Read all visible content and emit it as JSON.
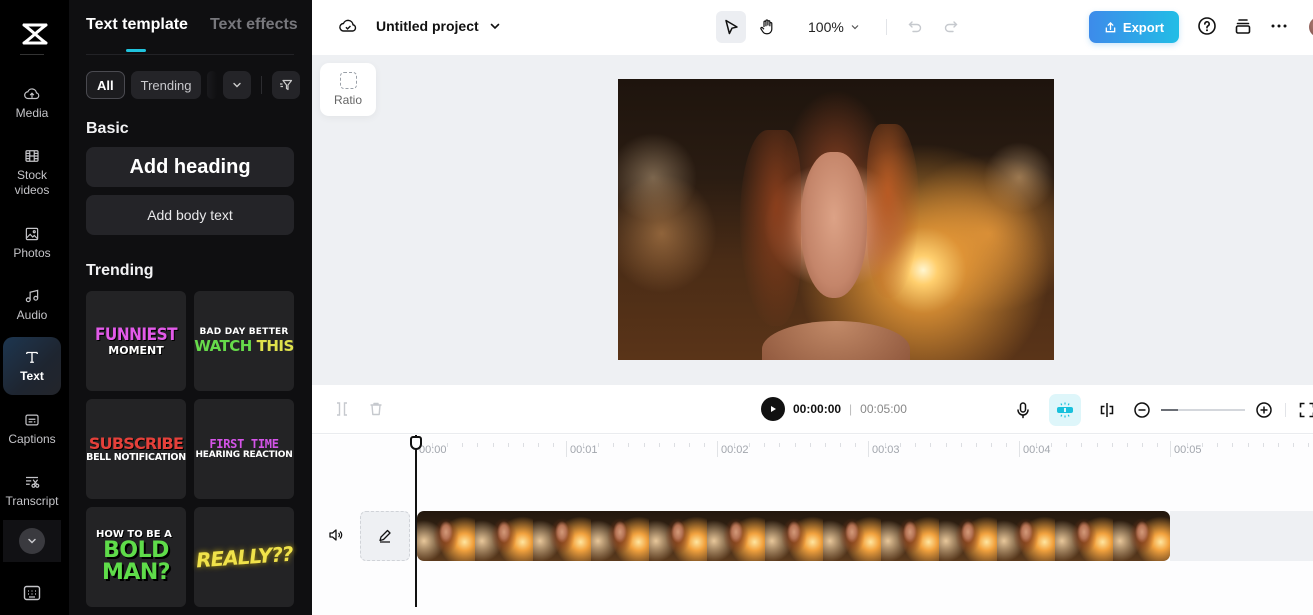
{
  "rail": {
    "logo": "capcut-logo",
    "items": [
      {
        "label": "Media",
        "icon": "cloud-upload-icon"
      },
      {
        "label": "Stock\nvideos",
        "icon": "film-icon"
      },
      {
        "label": "Photos",
        "icon": "image-icon"
      },
      {
        "label": "Audio",
        "icon": "music-note-icon"
      },
      {
        "label": "Text",
        "icon": "text-icon",
        "active": true
      },
      {
        "label": "Captions",
        "icon": "captions-icon"
      },
      {
        "label": "Transcript",
        "icon": "transcript-icon"
      }
    ],
    "more_icon": "chevron-down-icon",
    "keyboard_icon": "keyboard-icon"
  },
  "panel": {
    "tabs": [
      {
        "label": "Text template",
        "active": true
      },
      {
        "label": "Text effects",
        "active": false
      }
    ],
    "filters": [
      {
        "label": "All",
        "active": true
      },
      {
        "label": "Trending",
        "active": false
      }
    ],
    "basic_title": "Basic",
    "add_heading": "Add heading",
    "add_body": "Add body text",
    "trending_title": "Trending",
    "templates": [
      {
        "line1": "FUNNIEST",
        "line2": "MOMENT"
      },
      {
        "line1": "BAD DAY BETTER",
        "line2a": "WATCH",
        "line2b": "THIS"
      },
      {
        "line1": "SUBSCRIBE",
        "line2": "BELL NOTIFICATION"
      },
      {
        "line1": "FIRST TIME",
        "line2": "HEARING REACTION"
      },
      {
        "line1": "HOW TO BE A",
        "line2": "BOLD",
        "line3": "MAN?"
      },
      {
        "line1": "REALLY??"
      }
    ]
  },
  "topbar": {
    "project_name": "Untitled project",
    "zoom_level": "100%",
    "export_label": "Export"
  },
  "canvas": {
    "ratio_label": "Ratio"
  },
  "player": {
    "current_time": "00:00:00",
    "separator": "|",
    "total_time": "00:05:00",
    "zoom_slider_value": 0.2
  },
  "timeline": {
    "ruler_labels": [
      "00:00",
      "00:01",
      "00:02",
      "00:03",
      "00:04",
      "00:05"
    ],
    "clip_frames": 13
  },
  "colors": {
    "accent": "#20c3dd",
    "export_gradient_start": "#3d8bea",
    "export_gradient_end": "#22bde6"
  }
}
